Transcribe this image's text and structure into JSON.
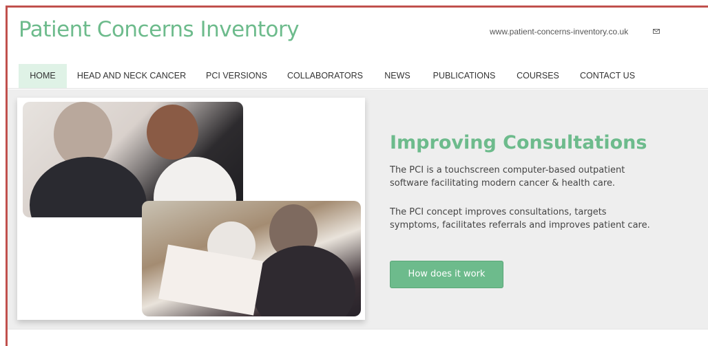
{
  "header": {
    "title": "Patient Concerns Inventory",
    "url": "www.patient-concerns-inventory.co.uk",
    "mail_icon": "mail-icon"
  },
  "nav": {
    "items": [
      {
        "label": "HOME",
        "active": true
      },
      {
        "label": "HEAD AND NECK CANCER"
      },
      {
        "label": "PCI VERSIONS"
      },
      {
        "label": "COLLABORATORS"
      },
      {
        "label": "NEWS"
      },
      {
        "label": "PUBLICATIONS"
      },
      {
        "label": "COURSES"
      },
      {
        "label": "CONTACT US"
      }
    ]
  },
  "hero": {
    "heading": "Improving Consultations",
    "paragraph1": "The PCI is a touchscreen computer-based outpatient software facilitating modern cancer & health care.",
    "paragraph2": "The PCI concept improves consultations, targets symptoms, facilitates referrals and improves patient care.",
    "button_label": "How does it work"
  },
  "colors": {
    "accent": "#6dbb8c",
    "frame": "#c0504d"
  }
}
